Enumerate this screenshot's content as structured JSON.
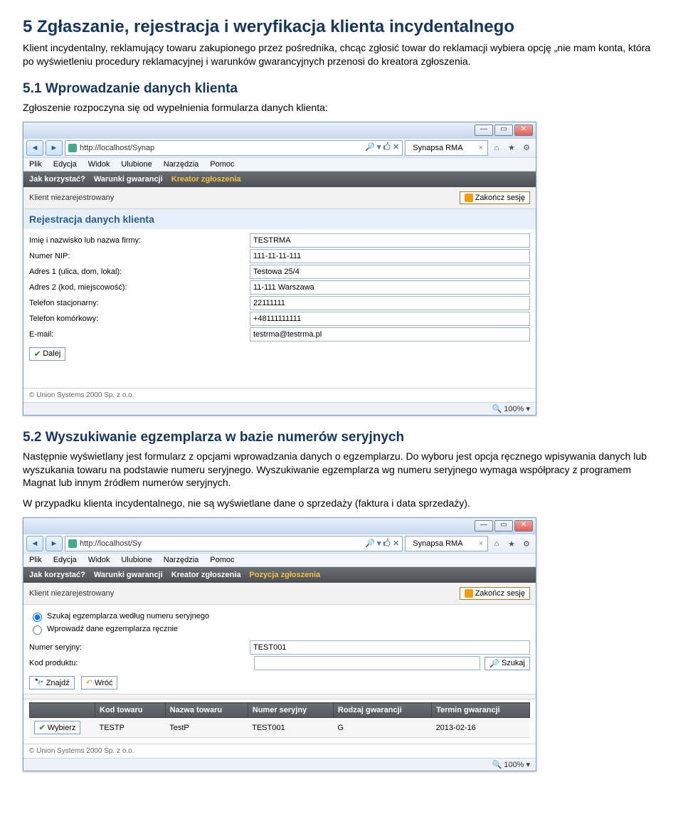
{
  "heading1": "5   Zgłaszanie, rejestracja i weryfikacja klienta incydentalnego",
  "para1": "Klient incydentalny, reklamujący towaru zakupionego przez pośrednika, chcąc zgłosić towar do reklamacji wybiera opcję „nie mam konta, która po wyświetleniu procedury reklamacyjnej i warunków gwarancyjnych przenosi do kreatora zgłoszenia.",
  "heading2": "5.1   Wprowadzanie danych klienta",
  "para2": "Zgłoszenie rozpoczyna się od wypełnienia formularza danych klienta:",
  "heading3": "5.2   Wyszukiwanie egzemplarza w bazie numerów seryjnych",
  "para3": "Następnie wyświetlany jest formularz z opcjami wprowadzania danych o egzemplarzu. Do wyboru jest opcja ręcznego wpisywania danych lub wyszukania towaru na podstawie numeru seryjnego. Wyszukiwanie egzemplarza wg numeru seryjnego wymaga współpracy z programem Magnat lub innym źródłem numerów seryjnych.",
  "para4": "W przypadku klienta incydentalnego, nie są wyświetlane dane o sprzedaży (faktura i data sprzedaży).",
  "win": {
    "min": "—",
    "max": "▭",
    "close": "✕"
  },
  "s1": {
    "url": "http://localhost/Synap",
    "tabtitle": "Synapsa RMA",
    "menu": {
      "plik": "Plik",
      "edycja": "Edycja",
      "widok": "Widok",
      "ulubione": "Ulubione",
      "narzedzia": "Narzędzia",
      "pomoc": "Pomoc"
    },
    "appnav": {
      "a": "Jak korzystać?",
      "b": "Warunki gwarancji",
      "c": "Kreator zgłoszenia"
    },
    "user": "Klient niezarejestrowany",
    "logout": "Zakończ sesję",
    "paneltitle": "Rejestracja danych klienta",
    "labels": {
      "l1": "Imię i nazwisko lub nazwa firmy:",
      "l2": "Numer NIP:",
      "l3": "Adres 1 (ulica, dom, lokal):",
      "l4": "Adres 2 (kod, miejscowość):",
      "l5": "Telefon stacjonarny:",
      "l6": "Telefon komórkowy:",
      "l7": "E-mail:"
    },
    "vals": {
      "v1": "TESTRMA",
      "v2": "111-11-11-111",
      "v3": "Testowa 25/4",
      "v4": "11-111 Warszawa",
      "v5": "22111111",
      "v6": "+48111111111",
      "v7": "testrma@testrma.pl"
    },
    "next": "Dalej",
    "footer": "© Union Systems 2000 Sp. z o.o.",
    "zoom": "100%"
  },
  "s2": {
    "url": "http://localhost/Sy",
    "tabtitle": "Synapsa RMA",
    "menu": {
      "plik": "Plik",
      "edycja": "Edycja",
      "widok": "Widok",
      "ulubione": "Ulubione",
      "narzedzia": "Narzędzia",
      "pomoc": "Pomoc"
    },
    "appnav": {
      "a": "Jak korzystać?",
      "b": "Warunki gwarancji",
      "c": "Kreator zgłoszenia",
      "d": "Pozycja zgłoszenia"
    },
    "user": "Klient niezarejestrowany",
    "logout": "Zakończ sesję",
    "radio1": "Szukaj egzemplarza według numeru seryjnego",
    "radio2": "Wprowadź dane egzemplarza ręcznie",
    "labels": {
      "serial": "Numer seryjny:",
      "code": "Kod produktu:"
    },
    "vals": {
      "serial": "TEST001",
      "code": ""
    },
    "searchbtn": "Szukaj",
    "findbtn": "Znajdź",
    "backbtn": "Wróć",
    "table": {
      "h": {
        "a": "Kod towaru",
        "b": "Nazwa towaru",
        "c": "Numer seryjny",
        "d": "Rodzaj gwarancji",
        "e": "Termin gwarancji"
      },
      "r": {
        "a": "TESTP",
        "b": "TestP",
        "c": "TEST001",
        "d": "G",
        "e": "2013-02-16"
      }
    },
    "choosebtn": "Wybierz",
    "footer": "© Union Systems 2000 Sp. z o.o.",
    "zoom": "100%"
  }
}
